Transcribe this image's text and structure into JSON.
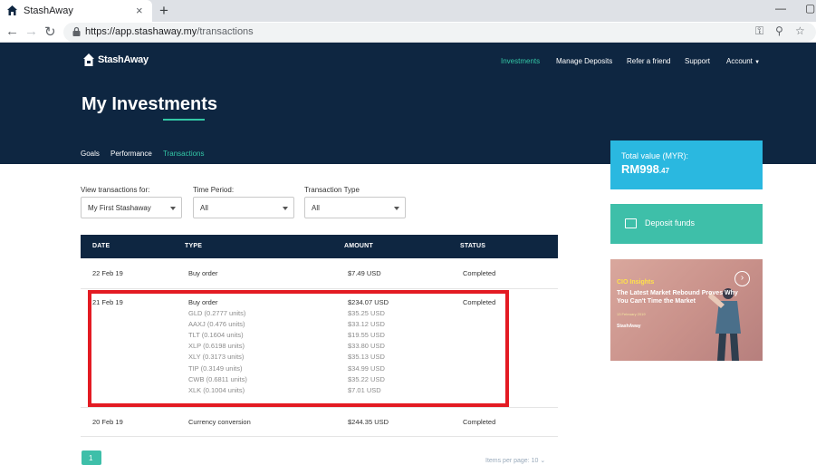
{
  "browser": {
    "tab_title": "StashAway",
    "close_glyph": "×",
    "new_tab_glyph": "+",
    "url_host": "https://app.stashaway.my",
    "url_path": "/transactions"
  },
  "header": {
    "logo_text": "StashAway",
    "nav": [
      "Investments",
      "Manage Deposits",
      "Refer a friend",
      "Support",
      "Account"
    ],
    "page_title": "My Investments",
    "tabs": [
      "Goals",
      "Performance",
      "Transactions"
    ],
    "active_tab": "Transactions"
  },
  "filters": {
    "view_label": "View transactions for:",
    "view_value": "My First Stashaway",
    "period_label": "Time Period:",
    "period_value": "All",
    "type_label": "Transaction Type",
    "type_value": "All"
  },
  "table": {
    "headers": [
      "DATE",
      "TYPE",
      "AMOUNT",
      "STATUS"
    ],
    "rows": [
      {
        "date": "22 Feb 19",
        "type": "Buy order",
        "amount": "$7.49 USD",
        "status": "Completed"
      },
      {
        "date": "21 Feb 19",
        "type": "Buy order",
        "amount": "$234.07 USD",
        "status": "Completed",
        "details": [
          {
            "type": "GLD (0.2777 units)",
            "amount": "$35.25 USD"
          },
          {
            "type": "AAXJ (0.476 units)",
            "amount": "$33.12 USD"
          },
          {
            "type": "TLT (0.1604 units)",
            "amount": "$19.55 USD"
          },
          {
            "type": "XLP (0.6198 units)",
            "amount": "$33.80 USD"
          },
          {
            "type": "XLY (0.3173 units)",
            "amount": "$35.13 USD"
          },
          {
            "type": "TIP (0.3149 units)",
            "amount": "$34.99 USD"
          },
          {
            "type": "CWB (0.6811 units)",
            "amount": "$35.22 USD"
          },
          {
            "type": "XLK (0.1004 units)",
            "amount": "$7.01 USD"
          }
        ]
      },
      {
        "date": "20 Feb 19",
        "type": "Currency conversion",
        "amount": "$244.35 USD",
        "status": "Completed"
      }
    ]
  },
  "pagination": {
    "current_page": "1",
    "items_per_page": "Items per page: 10"
  },
  "sidebar": {
    "total_label": "Total value (MYR):",
    "total_main": "RM998",
    "total_decimal": ".47",
    "deposit_label": "Deposit funds",
    "promo_tag": "CIO Insights",
    "promo_headline": "The Latest Market Rebound Proves Why You Can't Time the Market",
    "promo_date": "13 February 2019",
    "promo_logo": "StashAway",
    "promo_arrow": "›"
  },
  "colors": {
    "navy": "#0e2641",
    "teal": "#33c7a6",
    "sky": "#2ab8e0",
    "highlight": "#e31b23"
  }
}
